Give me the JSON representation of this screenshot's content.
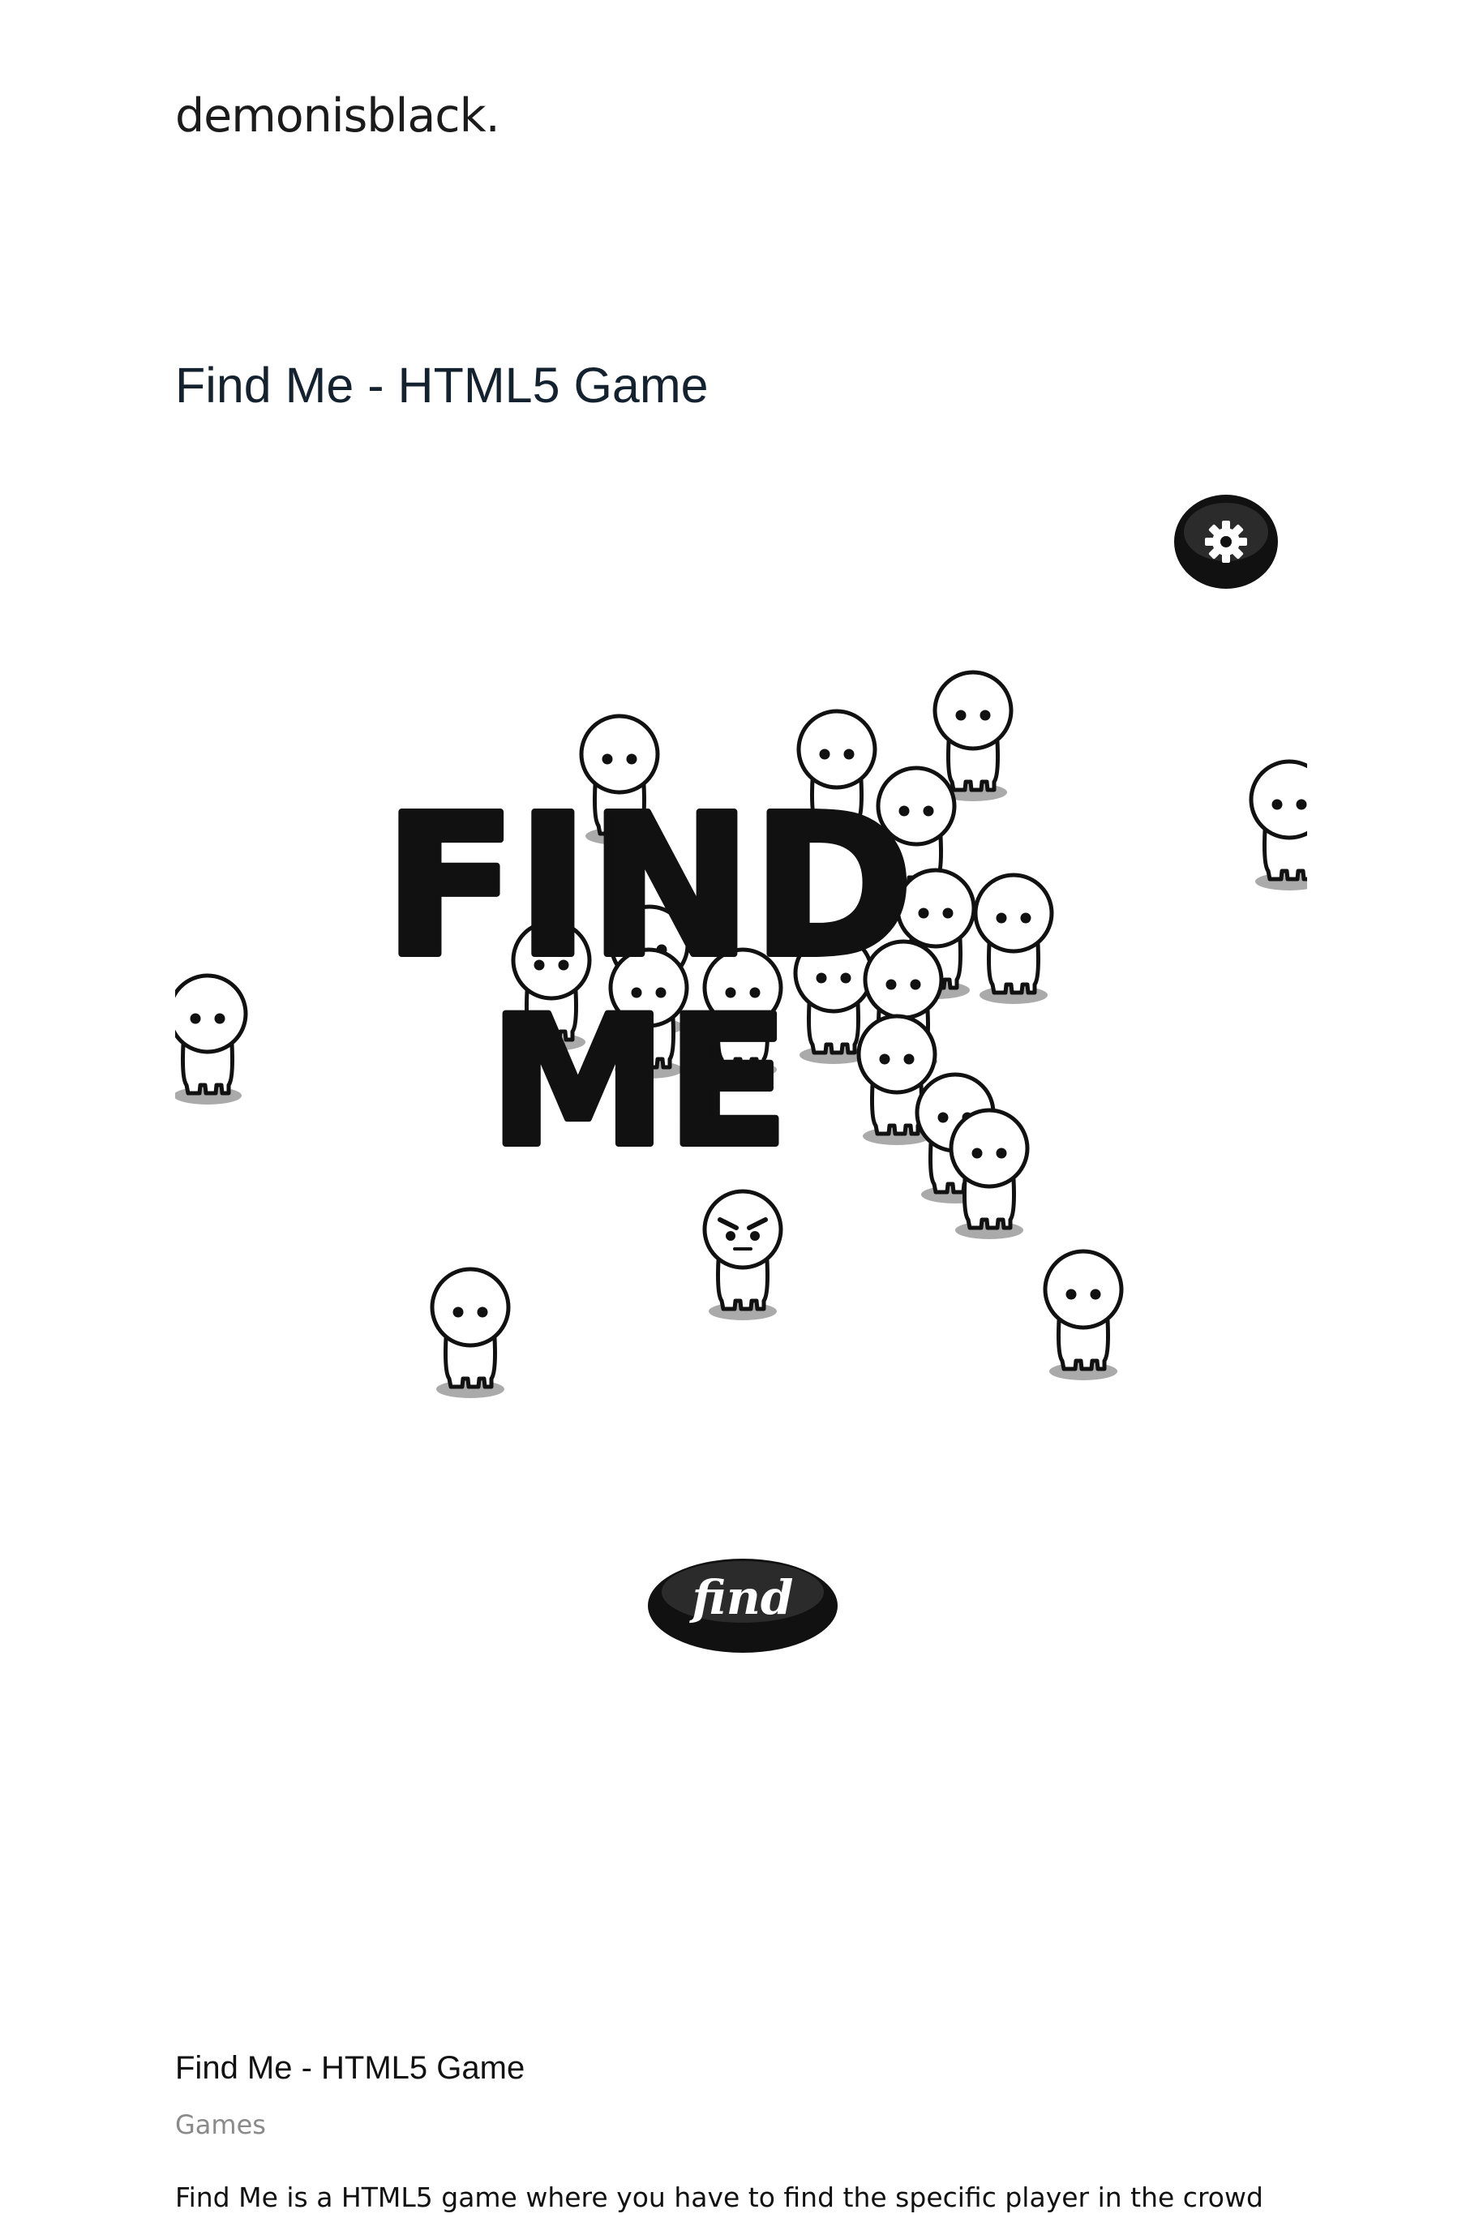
{
  "site": {
    "logo": "demonisblack."
  },
  "page": {
    "title": "Find Me - HTML5 Game"
  },
  "game": {
    "logo_line1": "FIND",
    "logo_line2": "ME",
    "find_button": "find",
    "settings_icon": "gear-icon"
  },
  "post": {
    "title": "Find Me - HTML5 Game",
    "category": "Games",
    "description": "Find Me is a HTML5 game where you have to find the specific player in the crowd"
  }
}
